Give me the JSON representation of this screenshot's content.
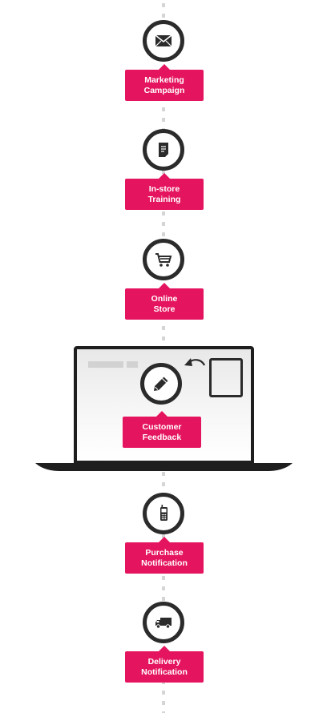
{
  "steps": [
    {
      "id": "marketing",
      "line1": "Marketing",
      "line2": "Campaign",
      "icon": "envelope-icon"
    },
    {
      "id": "training",
      "line1": "In-store",
      "line2": "Training",
      "icon": "document-icon"
    },
    {
      "id": "online",
      "line1": "Online",
      "line2": "Store",
      "icon": "shopping-cart-icon"
    },
    {
      "id": "feedback",
      "line1": "Customer",
      "line2": "Feedback",
      "icon": "pencil-icon"
    },
    {
      "id": "purchase",
      "line1": "Purchase",
      "line2": "Notification",
      "icon": "mobile-phone-icon"
    },
    {
      "id": "delivery",
      "line1": "Delivery",
      "line2": "Notification",
      "icon": "delivery-truck-icon"
    }
  ],
  "colors": {
    "accent": "#e5145e",
    "dark": "#2b2b2b",
    "dash": "#d5d5d5"
  }
}
